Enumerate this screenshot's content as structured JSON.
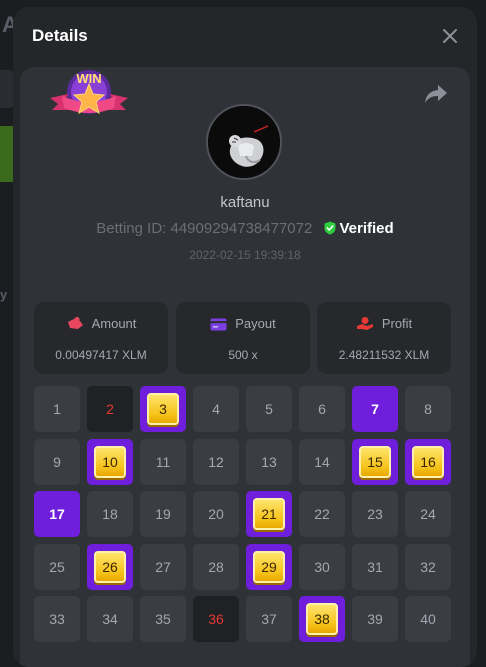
{
  "modal": {
    "title": "Details"
  },
  "player": {
    "username": "kaftanu",
    "betting_id_label": "Betting ID:",
    "betting_id": "4490929473847707​2",
    "verified_label": "Verified",
    "timestamp": "2022-02-15 19:39:18"
  },
  "stats": {
    "amount": {
      "label": "Amount",
      "value": "0.00497417 XLM"
    },
    "payout": {
      "label": "Payout",
      "value": "500 x"
    },
    "profit": {
      "label": "Profit",
      "value": "2.48211532 XLM"
    }
  },
  "keno_grid": {
    "columns": 8,
    "numbers": [
      "1",
      "2",
      "3",
      "4",
      "5",
      "6",
      "7",
      "8",
      "9",
      "10",
      "11",
      "12",
      "13",
      "14",
      "15",
      "16",
      "17",
      "18",
      "19",
      "20",
      "21",
      "22",
      "23",
      "24",
      "25",
      "26",
      "27",
      "28",
      "29",
      "30",
      "31",
      "32",
      "33",
      "34",
      "35",
      "36",
      "37",
      "38",
      "39",
      "40"
    ],
    "hits": [
      3,
      10,
      15,
      16,
      21,
      26,
      29,
      38
    ],
    "selected_no_hit": [
      7,
      17
    ],
    "drawn_no_pick": [
      2,
      36
    ]
  },
  "colors": {
    "selected": "#6f1fdc",
    "hit_gem": "#f5c21a",
    "miss_red": "#e53935",
    "verified_green": "#2ecc40",
    "amount_icon": "#e8475f",
    "payout_icon": "#7b3fe4",
    "profit_icon": "#e53935"
  },
  "icons": {
    "close": "close-icon",
    "share": "share-icon",
    "win_badge": "win-badge",
    "verified": "verified-shield-icon"
  }
}
